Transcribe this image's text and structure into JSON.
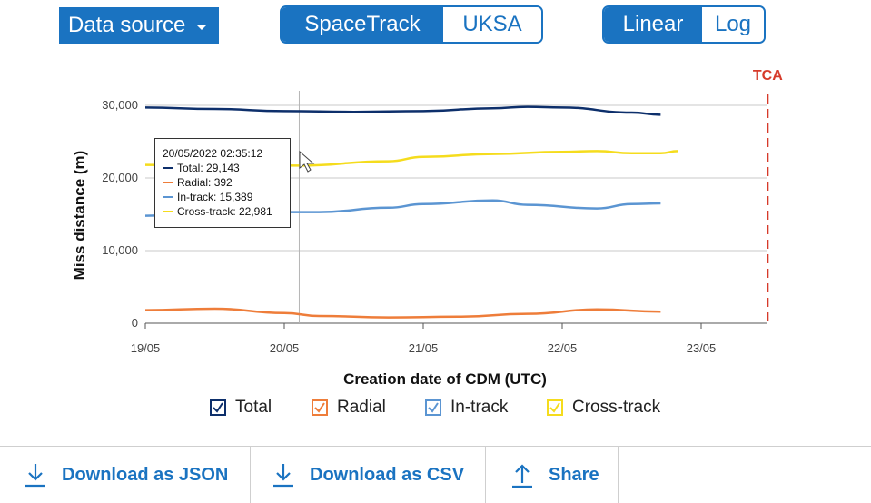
{
  "toolbar": {
    "data_source_label": "Data source",
    "source_options": [
      "SpaceTrack",
      "UKSA"
    ],
    "source_selected": "SpaceTrack",
    "scale_options": [
      "Linear",
      "Log"
    ],
    "scale_selected": "Linear"
  },
  "tooltip": {
    "datetime": "20/05/2022 02:35:12",
    "rows": [
      {
        "label": "Total: 29,143",
        "color": "#0d2f6b"
      },
      {
        "label": "Radial: 392",
        "color": "#ee7d3a"
      },
      {
        "label": "In-track: 15,389",
        "color": "#5b95d2"
      },
      {
        "label": "Cross-track: 22,981",
        "color": "#f5dc1d"
      }
    ]
  },
  "legend": [
    {
      "label": "Total",
      "color": "#0d2f6b",
      "checked": true
    },
    {
      "label": "Radial",
      "color": "#ee7d3a",
      "checked": true
    },
    {
      "label": "In-track",
      "color": "#5b95d2",
      "checked": true
    },
    {
      "label": "Cross-track",
      "color": "#f5dc1d",
      "checked": true
    }
  ],
  "actions": {
    "download_json": "Download as JSON",
    "download_csv": "Download as CSV",
    "share": "Share"
  },
  "chart_data": {
    "type": "line",
    "title": "",
    "xlabel": "Creation date of CDM (UTC)",
    "ylabel": "Miss distance (m)",
    "xlim": [
      "2022-05-19T00:00",
      "2022-05-23T12:00"
    ],
    "ylim": [
      0,
      30000
    ],
    "x_ticks": [
      "19/05",
      "20/05",
      "21/05",
      "22/05",
      "23/05"
    ],
    "y_ticks": [
      "0",
      "10,000",
      "20,000",
      "30,000"
    ],
    "y_tick_values": [
      0,
      10000,
      20000,
      30000
    ],
    "grid": "horizontal",
    "tca": {
      "label": "TCA",
      "x": "2022-05-23T11:30",
      "color": "#d63a2a"
    },
    "hover_x": "2022-05-20T02:35",
    "series": [
      {
        "name": "Total",
        "color": "#0d2f6b",
        "x": [
          "2022-05-19T00:00",
          "2022-05-19T12:00",
          "2022-05-20T00:00",
          "2022-05-20T12:00",
          "2022-05-21T00:00",
          "2022-05-21T12:00",
          "2022-05-21T18:00",
          "2022-05-22T00:00",
          "2022-05-22T12:00",
          "2022-05-22T17:00"
        ],
        "y": [
          29700,
          29500,
          29200,
          29100,
          29200,
          29600,
          29800,
          29700,
          29000,
          28700
        ]
      },
      {
        "name": "Radial",
        "color": "#ee7d3a",
        "x": [
          "2022-05-19T00:00",
          "2022-05-19T12:00",
          "2022-05-20T00:00",
          "2022-05-20T06:00",
          "2022-05-20T18:00",
          "2022-05-21T06:00",
          "2022-05-21T18:00",
          "2022-05-22T06:00",
          "2022-05-22T17:00"
        ],
        "y": [
          1800,
          2000,
          1400,
          1000,
          800,
          900,
          1300,
          1900,
          1600
        ]
      },
      {
        "name": "In-track",
        "color": "#5b95d2",
        "x": [
          "2022-05-19T00:00",
          "2022-05-19T12:00",
          "2022-05-20T00:00",
          "2022-05-20T06:00",
          "2022-05-20T18:00",
          "2022-05-21T00:00",
          "2022-05-21T12:00",
          "2022-05-21T18:00",
          "2022-05-22T06:00",
          "2022-05-22T12:00",
          "2022-05-22T17:00"
        ],
        "y": [
          14800,
          15100,
          15300,
          15300,
          15900,
          16400,
          16900,
          16300,
          15800,
          16400,
          16500
        ]
      },
      {
        "name": "Cross-track",
        "color": "#f5dc1d",
        "x": [
          "2022-05-19T00:00",
          "2022-05-20T02:35",
          "2022-05-20T18:00",
          "2022-05-21T00:00",
          "2022-05-21T12:00",
          "2022-05-22T00:00",
          "2022-05-22T06:00",
          "2022-05-22T12:00",
          "2022-05-22T17:00",
          "2022-05-22T20:00"
        ],
        "y": [
          21800,
          21700,
          22300,
          22900,
          23300,
          23600,
          23700,
          23400,
          23400,
          23700
        ]
      }
    ]
  }
}
